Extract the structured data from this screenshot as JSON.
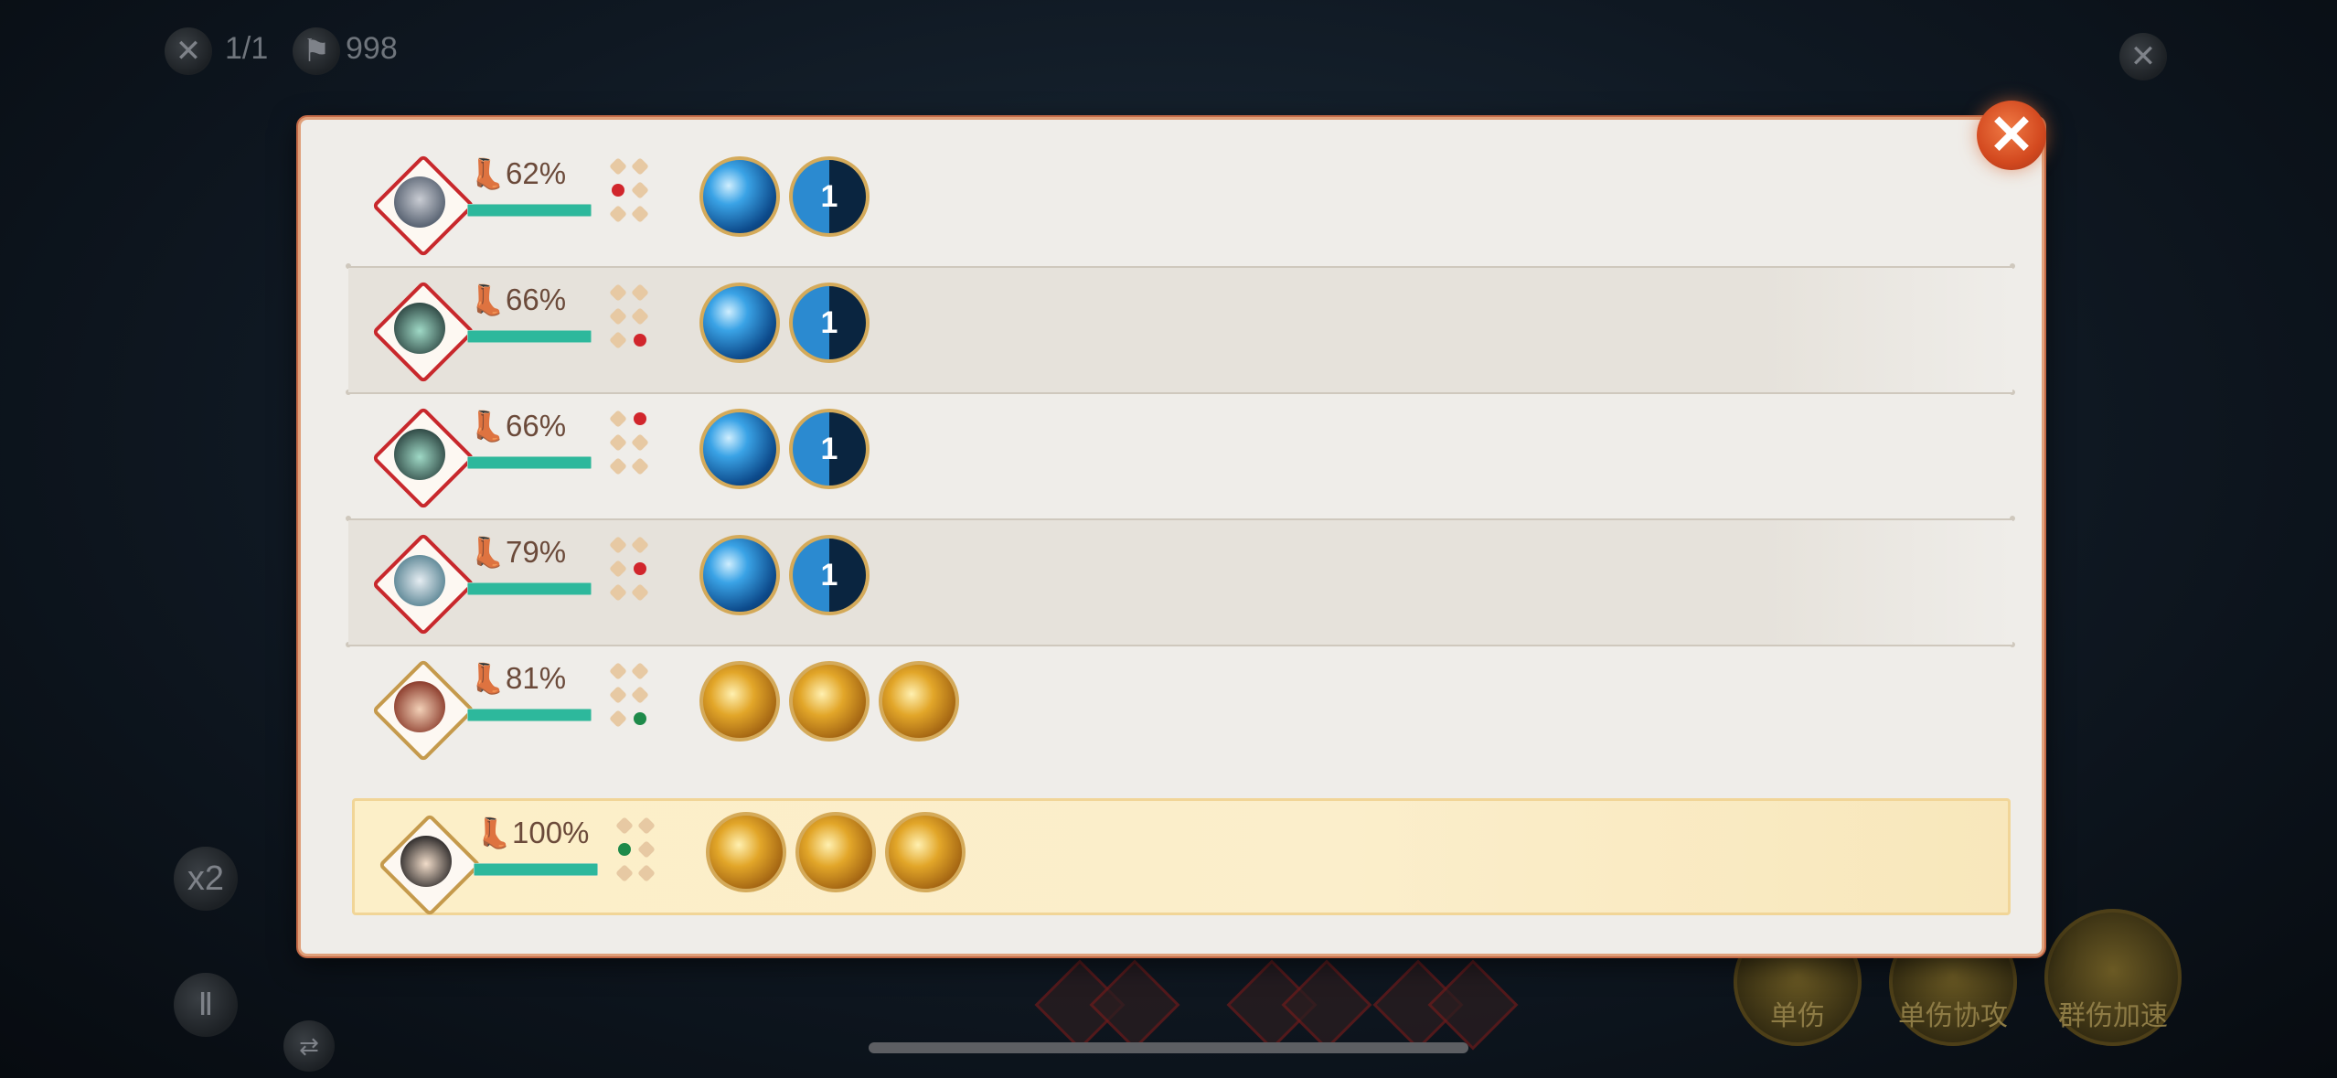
{
  "hud": {
    "battles": "1/1",
    "gold": "998",
    "speed": "x2"
  },
  "bottom_actions": [
    {
      "label": "单伤"
    },
    {
      "label": "单伤协攻"
    },
    {
      "label": "群伤加速"
    }
  ],
  "close_icon": "close-icon",
  "turn_order": [
    {
      "portrait": "armored-skull-hero",
      "speed": "62%",
      "fill": 1.0,
      "slot": [
        0,
        1,
        0,
        0,
        0,
        0
      ],
      "dots": "left-middle",
      "skills": [
        {
          "icon": "blue-burst",
          "label": ""
        },
        {
          "icon": "blue-swirl",
          "label": "1"
        }
      ],
      "style": "plain"
    },
    {
      "portrait": "hooded-teal-monster",
      "speed": "66%",
      "fill": 1.0,
      "dots": "right-bottom",
      "skills": [
        {
          "icon": "blue-slash",
          "label": ""
        },
        {
          "icon": "blue-swirl",
          "label": "1"
        }
      ],
      "style": "shaded"
    },
    {
      "portrait": "hooded-teal-monster",
      "speed": "66%",
      "fill": 1.0,
      "dots": "right-top",
      "skills": [
        {
          "icon": "blue-slash",
          "label": ""
        },
        {
          "icon": "blue-swirl",
          "label": "1"
        }
      ],
      "style": "plain"
    },
    {
      "portrait": "white-beast",
      "speed": "79%",
      "fill": 1.0,
      "dots": "right-middle",
      "skills": [
        {
          "icon": "blue-bolt",
          "label": ""
        },
        {
          "icon": "blue-swirl",
          "label": "1"
        }
      ],
      "style": "shaded"
    },
    {
      "portrait": "red-hair-hero",
      "speed": "81%",
      "fill": 1.0,
      "dots": "right-bottom-green",
      "skills": [
        {
          "icon": "gold-slash",
          "label": ""
        },
        {
          "icon": "gold-figure",
          "label": ""
        },
        {
          "icon": "gold-ring",
          "label": ""
        }
      ],
      "style": "plain"
    },
    {
      "portrait": "dark-hair-hero",
      "speed": "100%",
      "fill": 1.0,
      "dots": "left-middle-green",
      "skills": [
        {
          "icon": "gold-swirl",
          "label": ""
        },
        {
          "icon": "gold-wave",
          "label": ""
        },
        {
          "icon": "gold-spark",
          "label": ""
        }
      ],
      "style": "active"
    }
  ],
  "colors": {
    "panel_bg": "#efede9",
    "enemy_border": "#c8282c",
    "ally_border": "#c59a4c",
    "speed_bar": "#2db89c",
    "active_row": "#fcefc8"
  }
}
